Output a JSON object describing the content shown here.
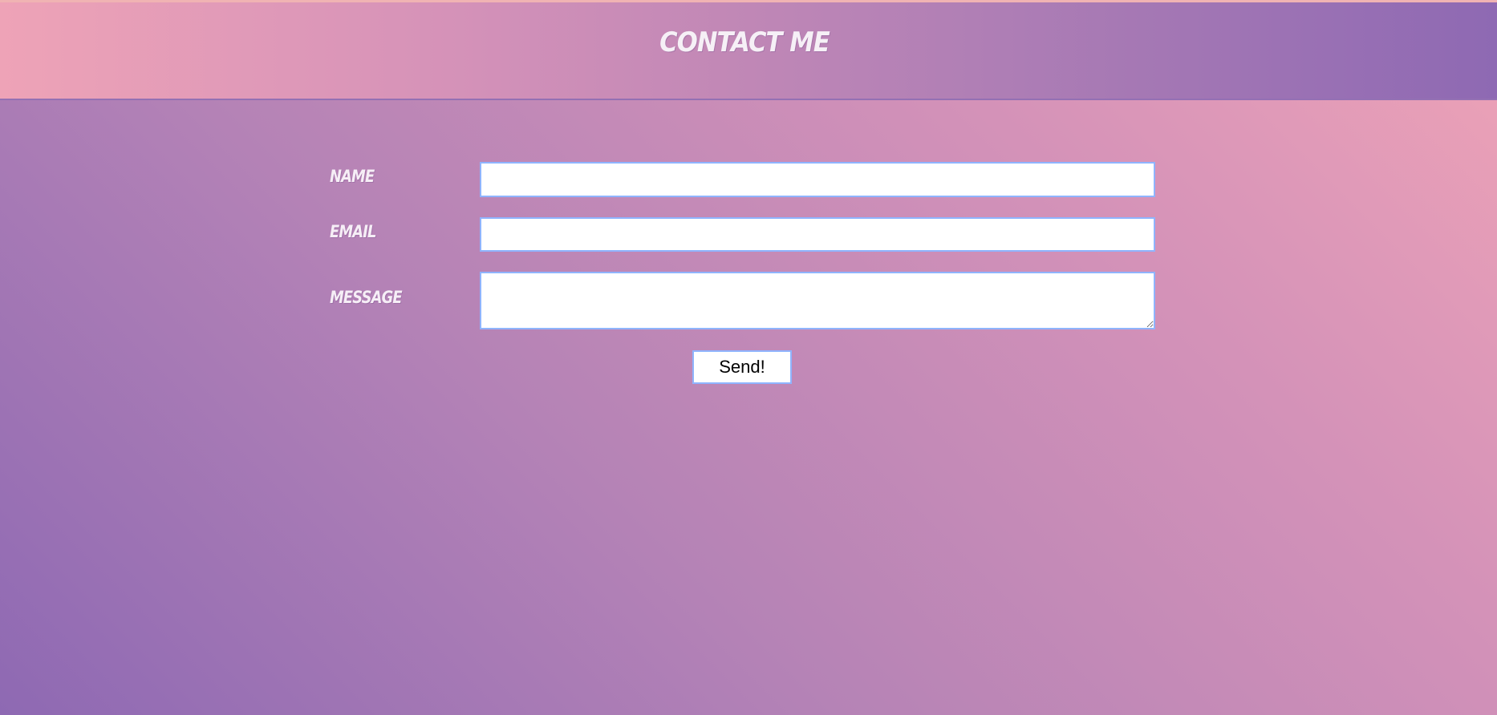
{
  "header": {
    "title": "Contact Me"
  },
  "form": {
    "name_label": "Name",
    "email_label": "Email",
    "message_label": "Message",
    "name_value": "",
    "email_value": "",
    "message_value": "",
    "submit_label": "Send!"
  },
  "colors": {
    "header_gradient_start": "#eea3b7",
    "header_gradient_end": "#8e69b3",
    "field_border": "#8fb4ff",
    "label_text": "#f6eef6"
  }
}
